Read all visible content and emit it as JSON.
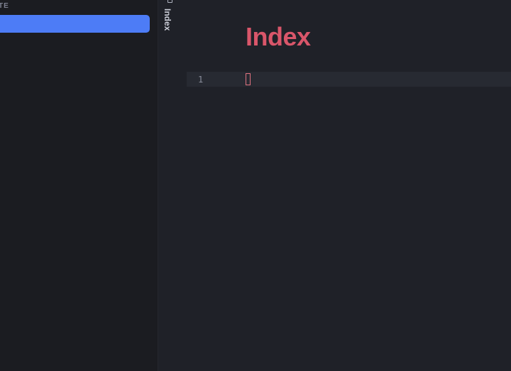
{
  "sidebar": {
    "heading": "TE"
  },
  "tab": {
    "label": "Index",
    "icon": "note-icon"
  },
  "editor": {
    "title": "Index",
    "line_numbers": [
      "1"
    ]
  },
  "colors": {
    "accent": "#4d7cf6",
    "title": "#d9566a",
    "background": "#1f2128",
    "sidebar_background": "#1b1c21"
  }
}
